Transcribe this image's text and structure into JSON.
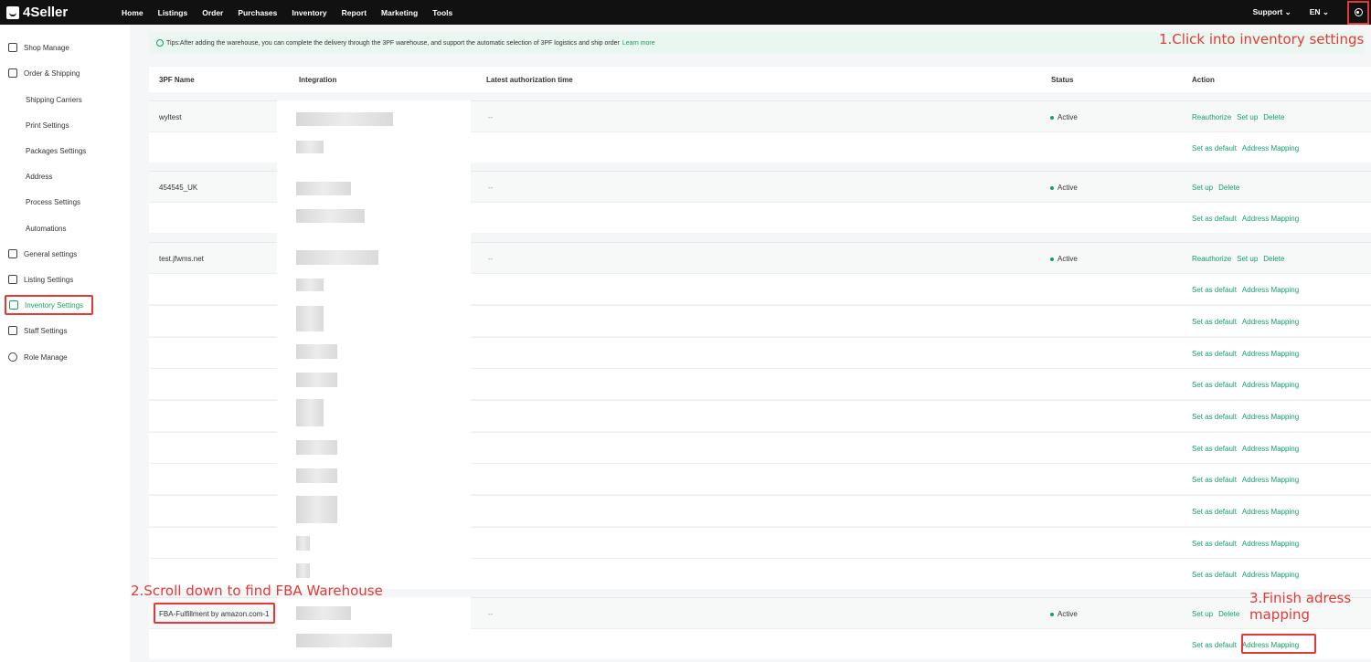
{
  "app": {
    "logo": "4Seller"
  },
  "nav": {
    "items": [
      "Home",
      "Listings",
      "Order",
      "Purchases",
      "Inventory",
      "Report",
      "Marketing",
      "Tools"
    ],
    "support": "Support ⌄",
    "lang": "EN ⌄"
  },
  "sidebar": {
    "items": [
      {
        "label": "Shop Manage",
        "icon": "shop-icon"
      },
      {
        "label": "Order & Shipping",
        "icon": "order-icon"
      },
      {
        "label": "Shipping Carriers"
      },
      {
        "label": "Print Settings"
      },
      {
        "label": "Packages Settings"
      },
      {
        "label": "Address"
      },
      {
        "label": "Process Settings"
      },
      {
        "label": "Automations"
      },
      {
        "label": "General settings",
        "icon": "general-icon"
      },
      {
        "label": "Listing Settings",
        "icon": "listing-icon"
      },
      {
        "label": "Inventory Settings",
        "icon": "inventory-icon"
      },
      {
        "label": "Staff Settings",
        "icon": "staff-icon"
      },
      {
        "label": "Role Manage",
        "icon": "role-icon"
      }
    ]
  },
  "tips": {
    "text": "Tips:After adding the warehouse, you can complete the delivery through the 3PF warehouse, and support the automatic selection of 3PF logistics and ship order",
    "learn": "Learn more"
  },
  "annotations": {
    "step1": "1.Click into inventory settings",
    "step2": "2.Scroll down to find FBA Warehouse",
    "step3": "3.Finish adress mapping"
  },
  "table": {
    "headers": {
      "name": "3PF Name",
      "integration": "Integration",
      "auth": "Latest authorization time",
      "status": "Status",
      "action": "Action"
    },
    "rows": [
      {
        "name": "wyltest",
        "auth": "--",
        "status": "Active",
        "actions": [
          "Reauthorize",
          "Set up",
          "Delete"
        ]
      },
      {
        "name": "454545_UK",
        "auth": "--",
        "status": "Active",
        "actions": [
          "Set up",
          "Delete"
        ]
      },
      {
        "name": "test.jfwms.net",
        "auth": "--",
        "status": "Active",
        "actions": [
          "Reauthorize",
          "Set up",
          "Delete"
        ]
      },
      {
        "name": "FBA-Fulfillment by amazon.com-1",
        "auth": "--",
        "status": "Active",
        "actions": [
          "Set up",
          "Delete"
        ]
      }
    ],
    "sub_actions": [
      "Set as default",
      "Address Mapping"
    ]
  }
}
